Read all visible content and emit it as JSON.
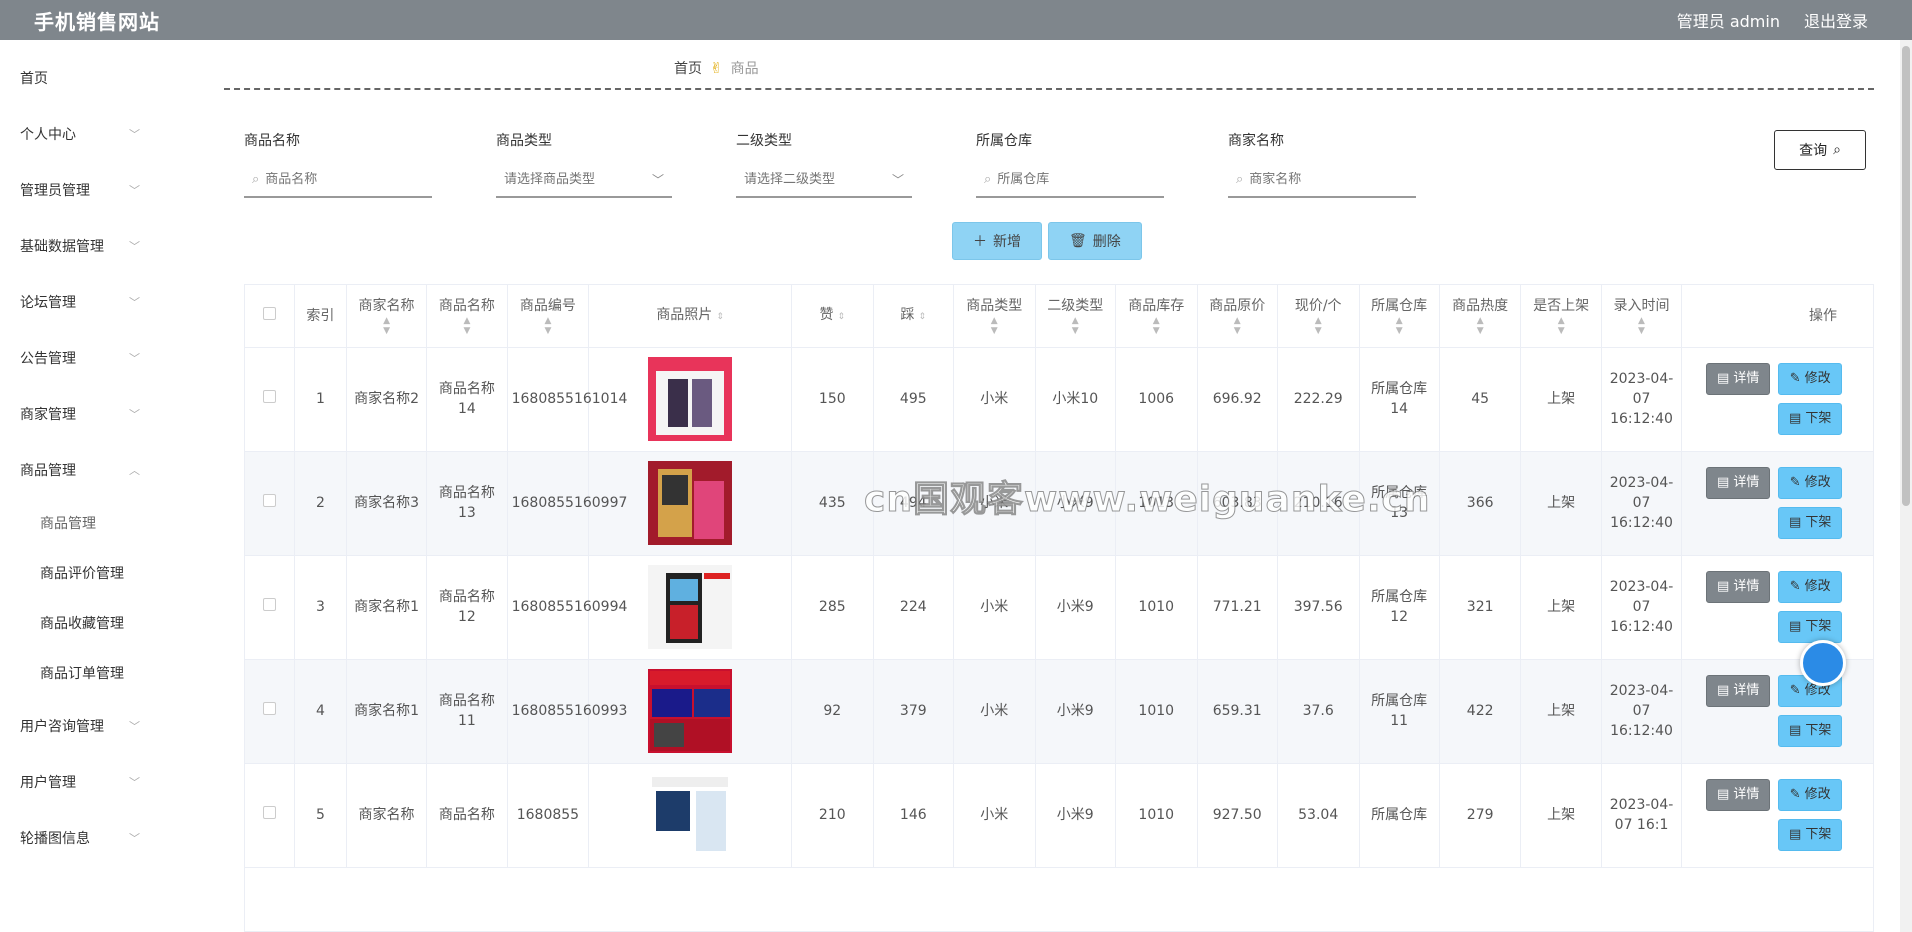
{
  "header": {
    "title": "手机销售网站",
    "admin": "管理员 admin",
    "logout": "退出登录"
  },
  "sidebar": {
    "items": [
      {
        "label": "首页",
        "chevron": false
      },
      {
        "label": "个人中心",
        "chevron": true
      },
      {
        "label": "管理员管理",
        "chevron": true
      },
      {
        "label": "基础数据管理",
        "chevron": true
      },
      {
        "label": "论坛管理",
        "chevron": true
      },
      {
        "label": "公告管理",
        "chevron": true
      },
      {
        "label": "商家管理",
        "chevron": true
      },
      {
        "label": "商品管理",
        "chevron": true,
        "expanded": true
      }
    ],
    "subitems": [
      "商品管理",
      "商品评价管理",
      "商品收藏管理",
      "商品订单管理"
    ],
    "items_after": [
      {
        "label": "用户咨询管理"
      },
      {
        "label": "用户管理"
      },
      {
        "label": "轮播图信息"
      }
    ]
  },
  "breadcrumb": {
    "home": "首页",
    "current": "商品"
  },
  "search": {
    "fields": [
      {
        "label": "商品名称",
        "placeholder": "商品名称",
        "type": "input"
      },
      {
        "label": "商品类型",
        "placeholder": "请选择商品类型",
        "type": "select"
      },
      {
        "label": "二级类型",
        "placeholder": "请选择二级类型",
        "type": "select"
      },
      {
        "label": "所属仓库",
        "placeholder": "所属仓库",
        "type": "input"
      },
      {
        "label": "商家名称",
        "placeholder": "商家名称",
        "type": "input"
      }
    ],
    "query_label": "查询"
  },
  "actions": {
    "add_label": "新增",
    "delete_label": "删除"
  },
  "table": {
    "columns": [
      "索引",
      "商家名称",
      "商品名称",
      "商品编号",
      "商品照片",
      "赞",
      "踩",
      "商品类型",
      "二级类型",
      "商品库存",
      "商品原价",
      "现价/个",
      "所属仓库",
      "商品热度",
      "是否上架",
      "录入时间",
      "操作"
    ],
    "rows": [
      {
        "index": "1",
        "shop": "商家名称2",
        "name": "商品名称14",
        "code": "1680855161014",
        "like": "150",
        "dislike": "495",
        "type": "小米",
        "subtype": "小米10",
        "stock": "1006",
        "orig": "696.92",
        "price": "222.29",
        "warehouse": "所属仓库14",
        "heat": "45",
        "onsale": "上架",
        "time": "2023-04-07 16:12:40",
        "img": "phone-ad"
      },
      {
        "index": "2",
        "shop": "商家名称3",
        "name": "商品名称13",
        "code": "1680855160997",
        "like": "435",
        "dislike": "494",
        "type": "小米",
        "subtype": "小米9",
        "stock": "1013",
        "orig": "603.83",
        "price": "210.16",
        "warehouse": "所属仓库13",
        "heat": "366",
        "onsale": "上架",
        "time": "2023-04-07 16:12:40",
        "img": "flip-phone"
      },
      {
        "index": "3",
        "shop": "商家名称1",
        "name": "商品名称12",
        "code": "1680855160994",
        "like": "285",
        "dislike": "224",
        "type": "小米",
        "subtype": "小米9",
        "stock": "1010",
        "orig": "771.21",
        "price": "397.56",
        "warehouse": "所属仓库12",
        "heat": "321",
        "onsale": "上架",
        "time": "2023-04-07 16:12:40",
        "img": "senior-phone"
      },
      {
        "index": "4",
        "shop": "商家名称1",
        "name": "商品名称11",
        "code": "1680855160993",
        "like": "92",
        "dislike": "379",
        "type": "小米",
        "subtype": "小米9",
        "stock": "1010",
        "orig": "659.31",
        "price": "37.6",
        "warehouse": "所属仓库11",
        "heat": "422",
        "onsale": "上架",
        "time": "2023-04-07 16:12:40",
        "img": "fold-ad"
      },
      {
        "index": "5",
        "shop": "商家名称",
        "name": "商品名称",
        "code": "1680855",
        "like": "210",
        "dislike": "146",
        "type": "小米",
        "subtype": "小米9",
        "stock": "1010",
        "orig": "927.50",
        "price": "53.04",
        "warehouse": "所属仓库",
        "heat": "279",
        "onsale": "上架",
        "time": "2023-04-07 16:1",
        "img": "honor-ad"
      }
    ],
    "op_labels": {
      "detail": "详情",
      "edit": "修改",
      "down": "下架"
    }
  },
  "watermark": "cn国观客www.weiguanke.cn",
  "colors": {
    "header": "#7f868c",
    "accent_button": "#68c7f7",
    "action_button": "#8fd3f4"
  }
}
